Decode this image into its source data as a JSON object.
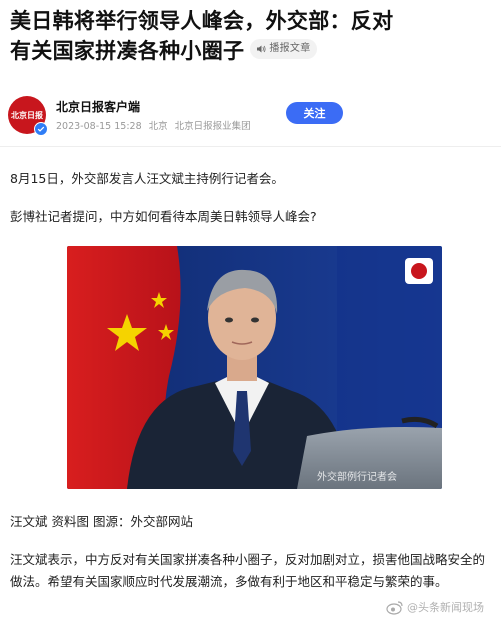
{
  "article": {
    "title_line1": "美日韩将举行领导人峰会，外交部：反对",
    "title_line2": "有关国家拼凑各种小圈子",
    "tts_label": "播报文章"
  },
  "author": {
    "avatar_text": "北京日报",
    "name": "北京日报客户端",
    "datetime": "2023-08-15 15:28",
    "location": "北京",
    "org": "北京日报报业集团",
    "follow_label": "关注"
  },
  "body": {
    "p1": "8月15日，外交部发言人汪文斌主持例行记者会。",
    "p2": "彭博社记者提问，中方如何看待本周美日韩领导人峰会?",
    "caption": "汪文斌 资料图 图源：外交部网站",
    "p3": "汪文斌表示，中方反对有关国家拼凑各种小圈子，反对加剧对立，损害他国战略安全的做法。希望有关国家顺应时代发展潮流，多做有利于地区和平稳定与繁荣的事。"
  },
  "image": {
    "overlay_text": "外交部例行记者会"
  },
  "watermark": {
    "text": "@头条新闻现场"
  },
  "colors": {
    "follow_button": "#3b6cf5",
    "brand_red": "#c8161d",
    "verified_blue": "#2f7df6"
  }
}
